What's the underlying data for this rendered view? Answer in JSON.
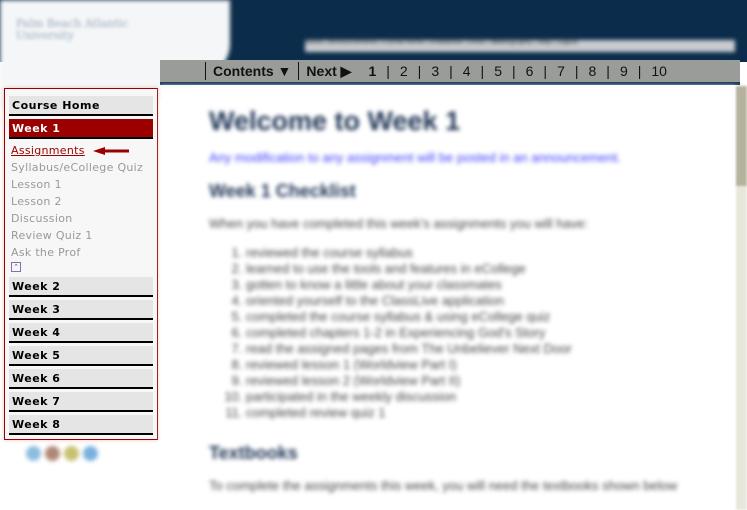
{
  "header": {
    "logo_text": "Palm Beach Atlantic University",
    "top_links": "Home | Announcements | Course Home | Gradebook | Email | Webliography | Help | Logout"
  },
  "navbar": {
    "contents": "Contents ▼",
    "next": "Next ▶",
    "pages": [
      "1",
      "2",
      "3",
      "4",
      "5",
      "6",
      "7",
      "8",
      "9",
      "10"
    ],
    "current_page": "1"
  },
  "sidebar": {
    "course_home": "Course Home",
    "week1": "Week 1",
    "links": [
      "Assignments",
      "Syllabus/eCollege Quiz",
      "Lesson 1",
      "Lesson 2",
      "Discussion",
      "Review Quiz 1",
      "Ask the Prof"
    ],
    "current_link": "Assignments",
    "weeks": [
      "Week 2",
      "Week 3",
      "Week 4",
      "Week 5",
      "Week 6",
      "Week 7",
      "Week 8"
    ],
    "accent": "#9b0000"
  },
  "main": {
    "title": "Welcome to Week 1",
    "note": "Any modification to any assignment will be posted in an announcement.",
    "checklist_heading": "Week 1 Checklist",
    "checklist_intro": "When you have completed this week's assignments you will have:",
    "checklist": [
      "reviewed the course syllabus",
      "learned to use the tools and features in eCollege",
      "gotten to know a little about your classmates",
      "oriented yourself to the ClassLive application",
      "completed the course syllabus & using eCollege quiz",
      "completed chapters 1-2 in Experiencing God's Story",
      "read the assigned pages from The Unbeliever Next Door",
      "reviewed lesson 1 (Worldview Part I)",
      "reviewed lesson 2 (Worldview Part II)",
      "participated in the weekly discussion",
      "completed review quiz 1"
    ],
    "textbooks_heading": "Textbooks",
    "textbooks_intro": "To complete the assignments this week, you will need the textbooks shown below"
  }
}
